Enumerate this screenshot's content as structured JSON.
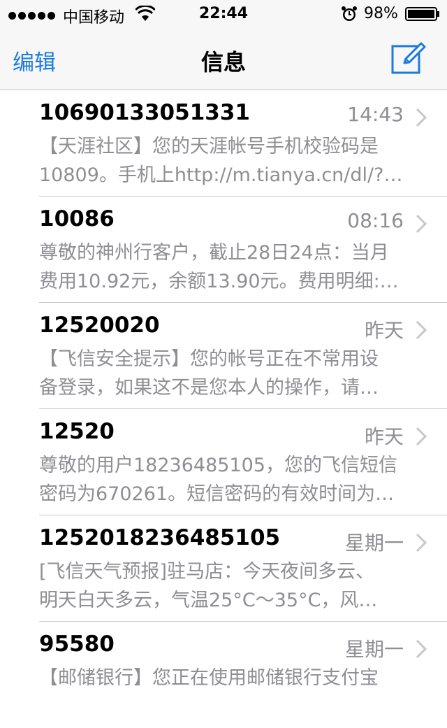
{
  "status_bar": {
    "carrier": "中国移动",
    "time": "22:44",
    "battery_percent": "98%"
  },
  "nav": {
    "edit_label": "编辑",
    "title": "信息",
    "compose_icon": "compose-icon"
  },
  "messages": [
    {
      "sender": "10690133051331",
      "time": "14:43",
      "preview_line1": "【天涯社区】您的天涯帐号手机校验码是",
      "preview_line2": "10809。手机上http://m.tianya.cn/dl/?…"
    },
    {
      "sender": "10086",
      "time": "08:16",
      "preview_line1": "尊敬的神州行客户，截止28日24点：当月",
      "preview_line2": "费用10.92元，余额13.90元。费用明细:…"
    },
    {
      "sender": "12520020",
      "time": "昨天",
      "preview_line1": "【飞信安全提示】您的帐号正在不常用设",
      "preview_line2": "备登录，如果这不是您本人的操作，请…"
    },
    {
      "sender": "12520",
      "time": "昨天",
      "preview_line1": "尊敬的用户18236485105，您的飞信短信",
      "preview_line2": "密码为670261。短信密码的有效时间为…"
    },
    {
      "sender": "1252018236485105",
      "time": "星期一",
      "preview_line1": "[飞信天气预报]驻马店：今天夜间多云、",
      "preview_line2": "明天白天多云，气温25°C～35°C，风…"
    },
    {
      "sender": "95580",
      "time": "星期一",
      "preview_line1": "【邮储银行】您正在使用邮储银行支付宝",
      "preview_line2": ""
    }
  ],
  "colors": {
    "accent": "#1a7ae0",
    "secondary_text": "#8e8e93",
    "separator": "#c8c7cc"
  }
}
